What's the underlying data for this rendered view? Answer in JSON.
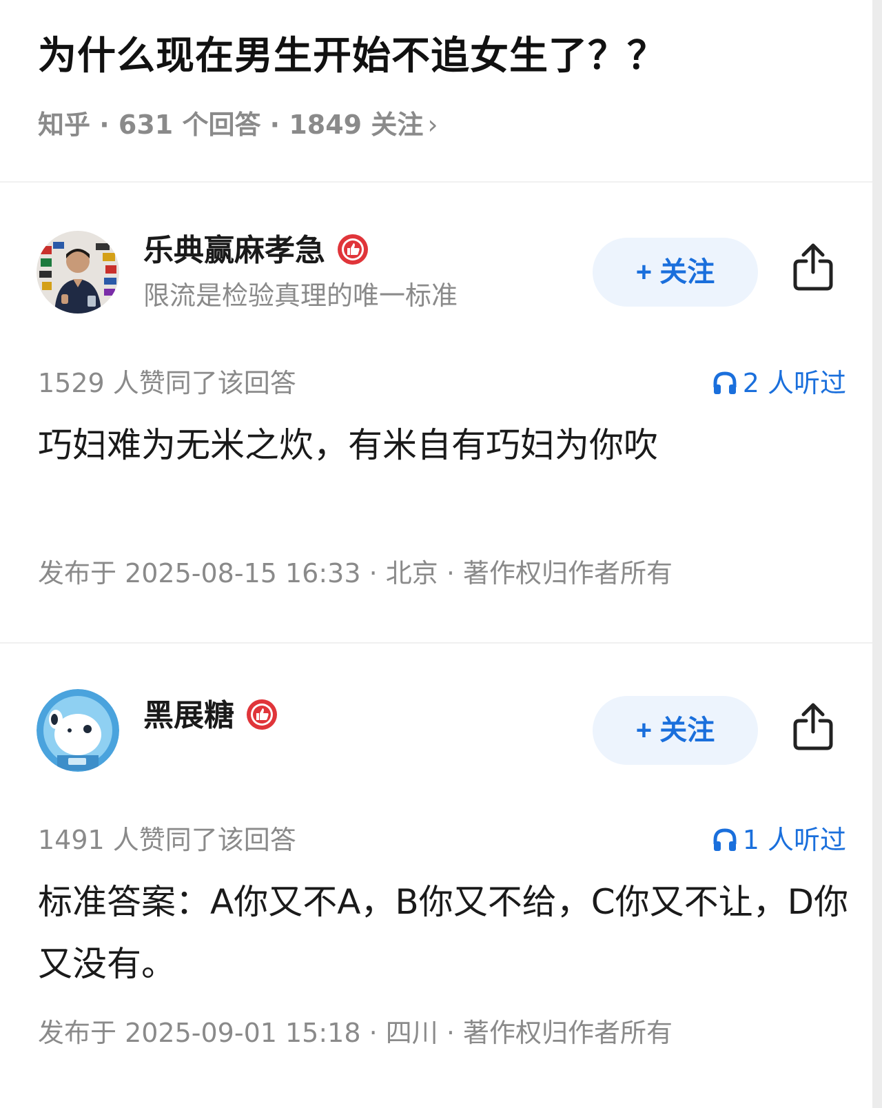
{
  "question": {
    "title": "为什么现在男生开始不追女生了？？",
    "meta": "知乎 · 631 个回答 · 1849 关注",
    "meta_chevron": "›"
  },
  "answers": [
    {
      "author_name": "乐典赢麻孝急",
      "author_bio": "限流是检验真理的唯一标准",
      "follow_label": "+ 关注",
      "upvotes": "1529 人赞同了该回答",
      "listens": "2 人听过",
      "content": "巧妇难为无米之炊，有米自有巧妇为你吹",
      "pubinfo": "发布于 2025-08-15 16:33 · 北京 · 著作权归作者所有",
      "avatar_icon": "person-photo-avatar",
      "badge_icon": "thumbs-up-badge-icon"
    },
    {
      "author_name": "黑展糖",
      "author_bio": "",
      "follow_label": "+ 关注",
      "upvotes": "1491 人赞同了该回答",
      "listens": "1 人听过",
      "content": "标准答案：A你又不A，B你又不给，C你又不让，D你又没有。",
      "pubinfo": "发布于 2025-09-01 15:18 · 四川 · 著作权归作者所有",
      "avatar_icon": "astronaut-dog-avatar",
      "badge_icon": "thumbs-up-badge-icon"
    }
  ],
  "colors": {
    "accent": "#1a6fdc",
    "follow_bg": "#edf4fd",
    "muted": "#8a8a8a",
    "badge_red": "#e0353a"
  }
}
